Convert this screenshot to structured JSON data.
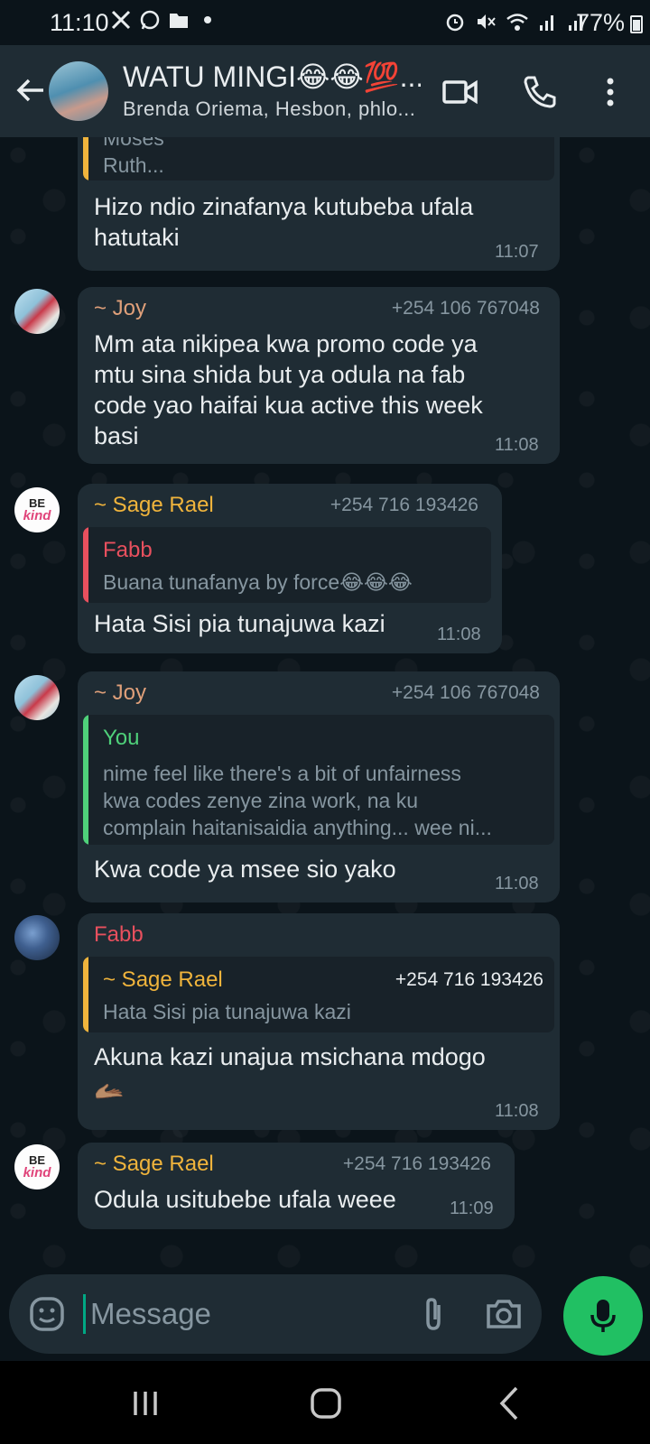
{
  "status_bar": {
    "time": "11:10",
    "battery": "77%",
    "left_icons": [
      "x-icon",
      "whatsapp-icon",
      "folder-icon",
      "dot-icon"
    ],
    "right_icons": [
      "alarm-icon",
      "mute-icon",
      "wifi-icon",
      "signal-icon",
      "signal-icon-2"
    ]
  },
  "header": {
    "title": "WATU MINGI😂😂💯...",
    "subtitle": "Brenda Oriema, Hesbon, phlo..."
  },
  "colors": {
    "background": "#0b141a",
    "bubble": "#1f2c34",
    "accent_green": "#21c063",
    "joy": "#e0a07a",
    "sage": "#f0b43c",
    "fabb": "#e8505e",
    "you": "#4fd17a"
  },
  "messages": [
    {
      "quoted_lines": [
        "Moses",
        "Ruth..."
      ],
      "text_lines": [
        "Hizo ndio zinafanya kutubeba ufala",
        "hatutaki"
      ],
      "time": "11:07"
    },
    {
      "sender": "~ Joy",
      "phone": "+254 106 767048",
      "text_lines": [
        "Mm ata nikipea kwa promo code ya",
        "mtu sina shida but ya odula na fab",
        "code yao haifai kua active this week",
        "basi"
      ],
      "time": "11:08"
    },
    {
      "sender": "~ Sage Rael",
      "phone": "+254 716 193426",
      "quote": {
        "author": "Fabb",
        "text": "Buana tunafanya by force😂😂😂"
      },
      "text": "Hata Sisi pia tunajuwa kazi",
      "time": "11:08"
    },
    {
      "sender": "~ Joy",
      "phone": "+254 106 767048",
      "quote": {
        "author": "You",
        "lines": [
          "nime feel like there's a bit of unfairness",
          "kwa codes zenye zina work,  na ku",
          "complain haitanisaidia anything... wee ni..."
        ]
      },
      "text": "Kwa code ya msee sio yako",
      "time": "11:08"
    },
    {
      "sender": "Fabb",
      "quote": {
        "author": "~ Sage Rael",
        "phone": "+254 716 193426",
        "text": "Hata Sisi pia tunajuwa kazi"
      },
      "text_lines": [
        "Akuna kazi unajua msichana mdogo",
        "🫴🏽"
      ],
      "time": "11:08"
    },
    {
      "sender": "~ Sage Rael",
      "phone": "+254 716 193426",
      "text": "Odula usitubebe ufala weee",
      "time": "11:09"
    }
  ],
  "avatars": {
    "sage_be": "BE",
    "sage_kind": "kind"
  },
  "composer": {
    "placeholder": "Message"
  }
}
